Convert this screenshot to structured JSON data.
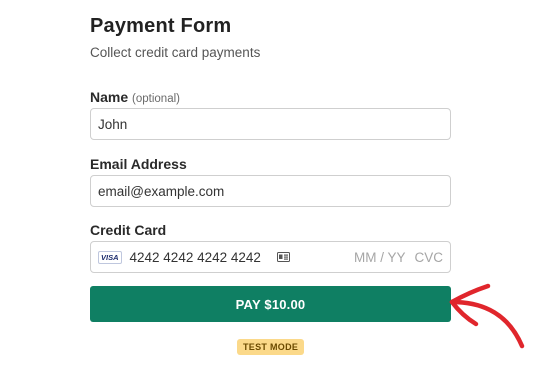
{
  "form": {
    "title": "Payment Form",
    "subtitle": "Collect credit card payments"
  },
  "fields": {
    "name": {
      "label": "Name",
      "optional_text": "(optional)",
      "value": "John"
    },
    "email": {
      "label": "Email Address",
      "value": "email@example.com"
    },
    "card": {
      "label": "Credit Card",
      "brand": "VISA",
      "number": "4242 4242 4242 4242",
      "expiry_placeholder": "MM / YY",
      "cvc_placeholder": "CVC",
      "card_icon": "card-details-icon"
    }
  },
  "pay_button": {
    "label": "PAY $10.00",
    "color": "#0f7f63"
  },
  "test_mode_badge": {
    "label": "TEST MODE",
    "color": "#fbd98a"
  },
  "annotation": {
    "icon": "red-hand-drawn-arrow",
    "color": "#e0262c"
  }
}
